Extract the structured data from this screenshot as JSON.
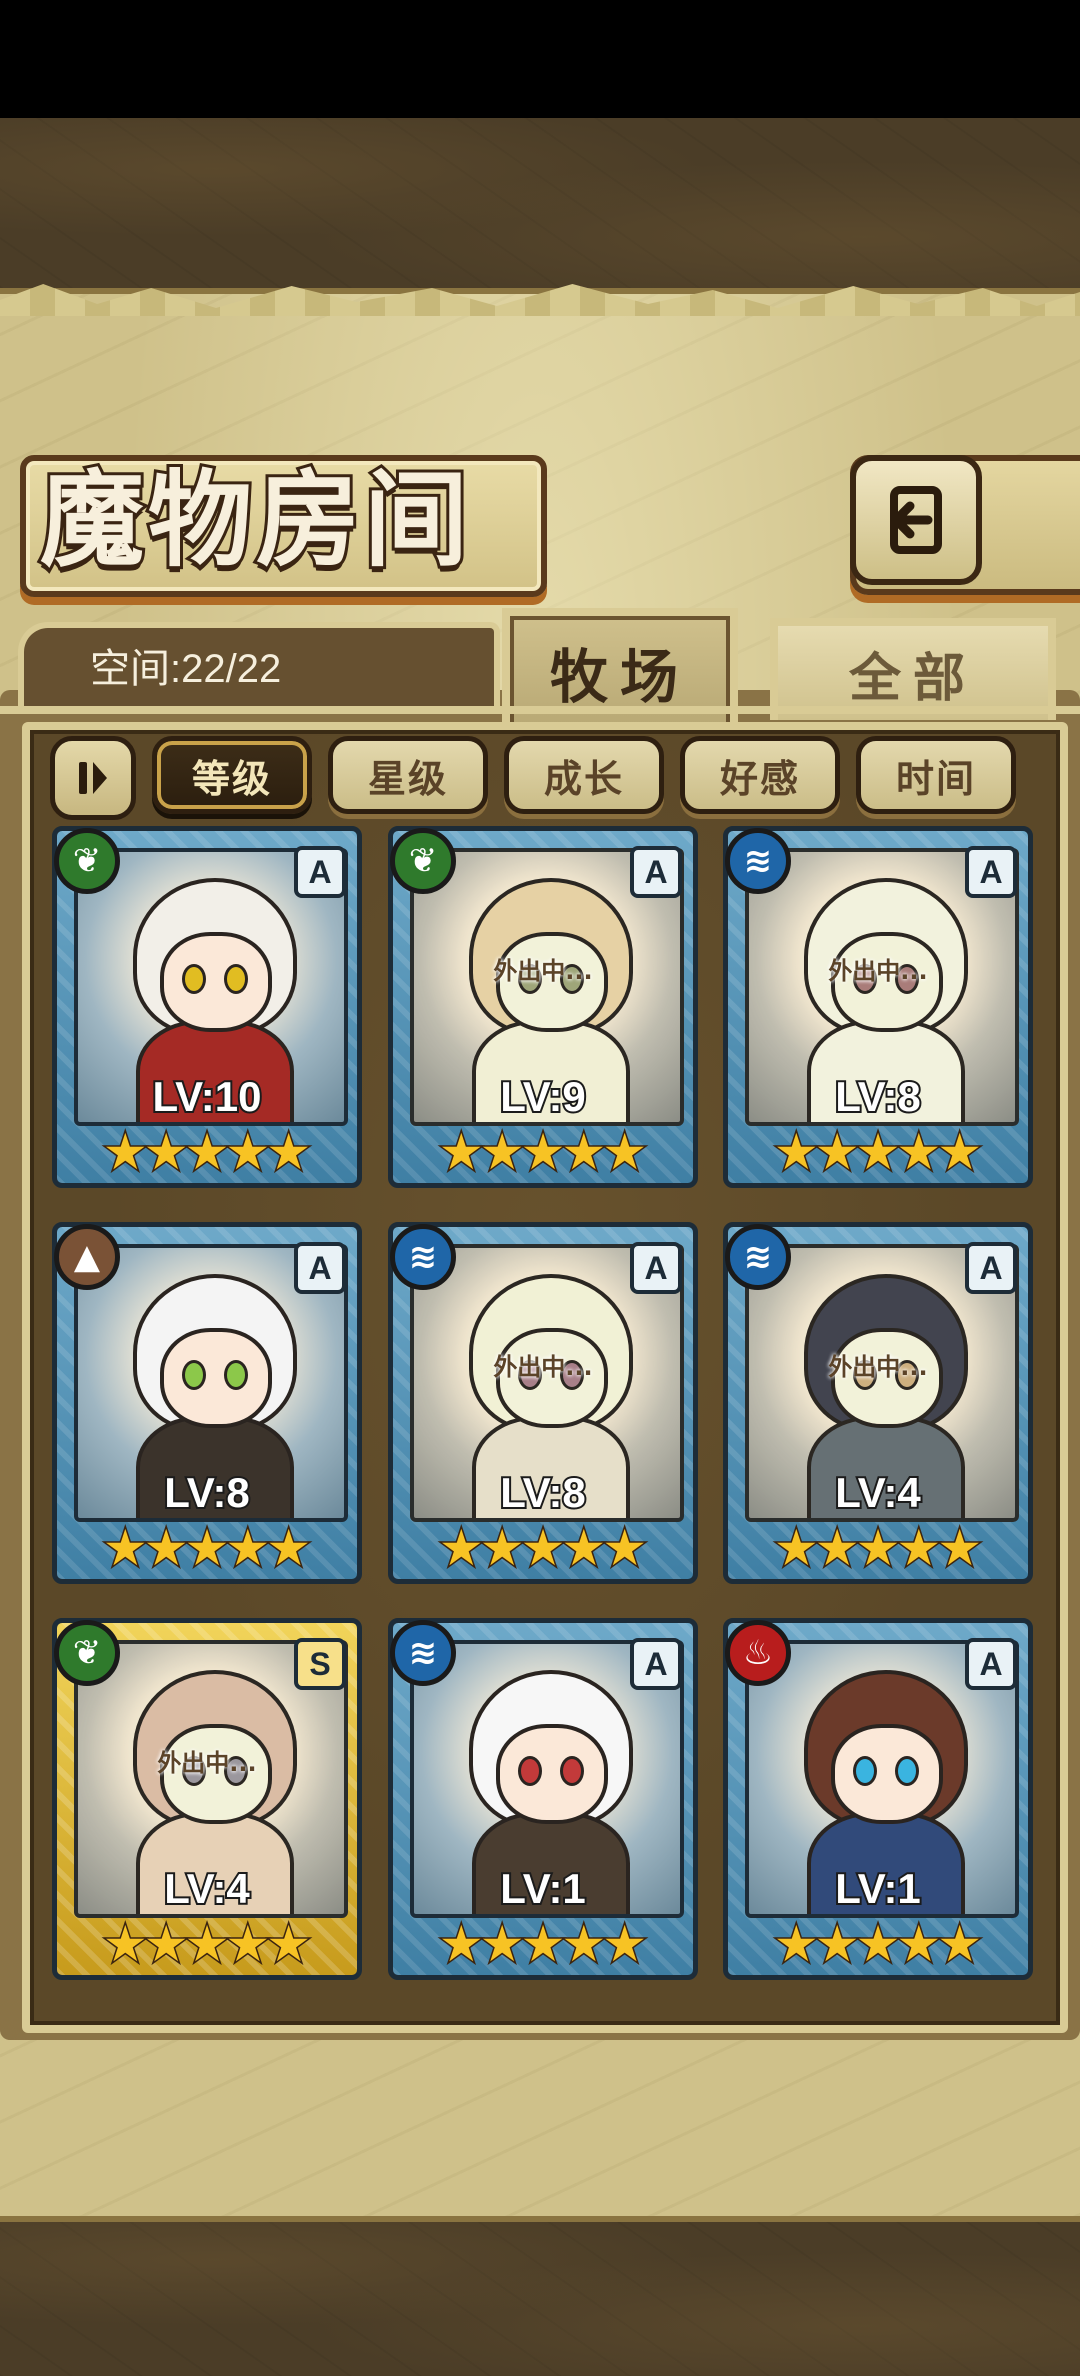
{
  "screen": {
    "title": "魔物房间",
    "capacity": "空间:22/22",
    "back_icon": "return-arrow-icon"
  },
  "tabs": [
    {
      "label": "牧场",
      "active": true
    },
    {
      "label": "全部",
      "active": false
    }
  ],
  "sort": {
    "pause_icon": "pause-icon",
    "options": [
      {
        "label": "等级",
        "active": true
      },
      {
        "label": "星级",
        "active": false
      },
      {
        "label": "成长",
        "active": false
      },
      {
        "label": "好感",
        "active": false
      },
      {
        "label": "时间",
        "active": false
      }
    ]
  },
  "cards": [
    {
      "level": "LV:10",
      "rank": "A",
      "element": "nature",
      "element_icon": "leaf-icon",
      "stars": 5,
      "away": false,
      "away_label": "",
      "frame": "blue"
    },
    {
      "level": "LV:9",
      "rank": "A",
      "element": "nature",
      "element_icon": "leaf-icon",
      "stars": 5,
      "away": true,
      "away_label": "外出中...",
      "frame": "blue"
    },
    {
      "level": "LV:8",
      "rank": "A",
      "element": "water",
      "element_icon": "water-waves-icon",
      "stars": 5,
      "away": true,
      "away_label": "外出中...",
      "frame": "blue"
    },
    {
      "level": "LV:8",
      "rank": "A",
      "element": "earth",
      "element_icon": "mountain-icon",
      "stars": 5,
      "away": false,
      "away_label": "",
      "frame": "blue"
    },
    {
      "level": "LV:8",
      "rank": "A",
      "element": "water",
      "element_icon": "water-waves-icon",
      "stars": 5,
      "away": true,
      "away_label": "外出中...",
      "frame": "blue"
    },
    {
      "level": "LV:4",
      "rank": "A",
      "element": "water",
      "element_icon": "water-waves-icon",
      "stars": 5,
      "away": true,
      "away_label": "外出中...",
      "frame": "blue"
    },
    {
      "level": "LV:4",
      "rank": "S",
      "element": "nature",
      "element_icon": "leaf-icon",
      "stars": 5,
      "away": true,
      "away_label": "外出中...",
      "frame": "gold"
    },
    {
      "level": "LV:1",
      "rank": "A",
      "element": "water",
      "element_icon": "water-waves-icon",
      "stars": 5,
      "away": false,
      "away_label": "",
      "frame": "blue"
    },
    {
      "level": "LV:1",
      "rank": "A",
      "element": "fire",
      "element_icon": "flame-icon",
      "stars": 5,
      "away": false,
      "away_label": "",
      "frame": "blue"
    }
  ],
  "colors": {
    "parchment": "#cfc18a",
    "panel": "#5b4828",
    "blue_frame": "#6ea9c9",
    "gold_frame": "#f1d45a",
    "star": "#f7c324"
  }
}
